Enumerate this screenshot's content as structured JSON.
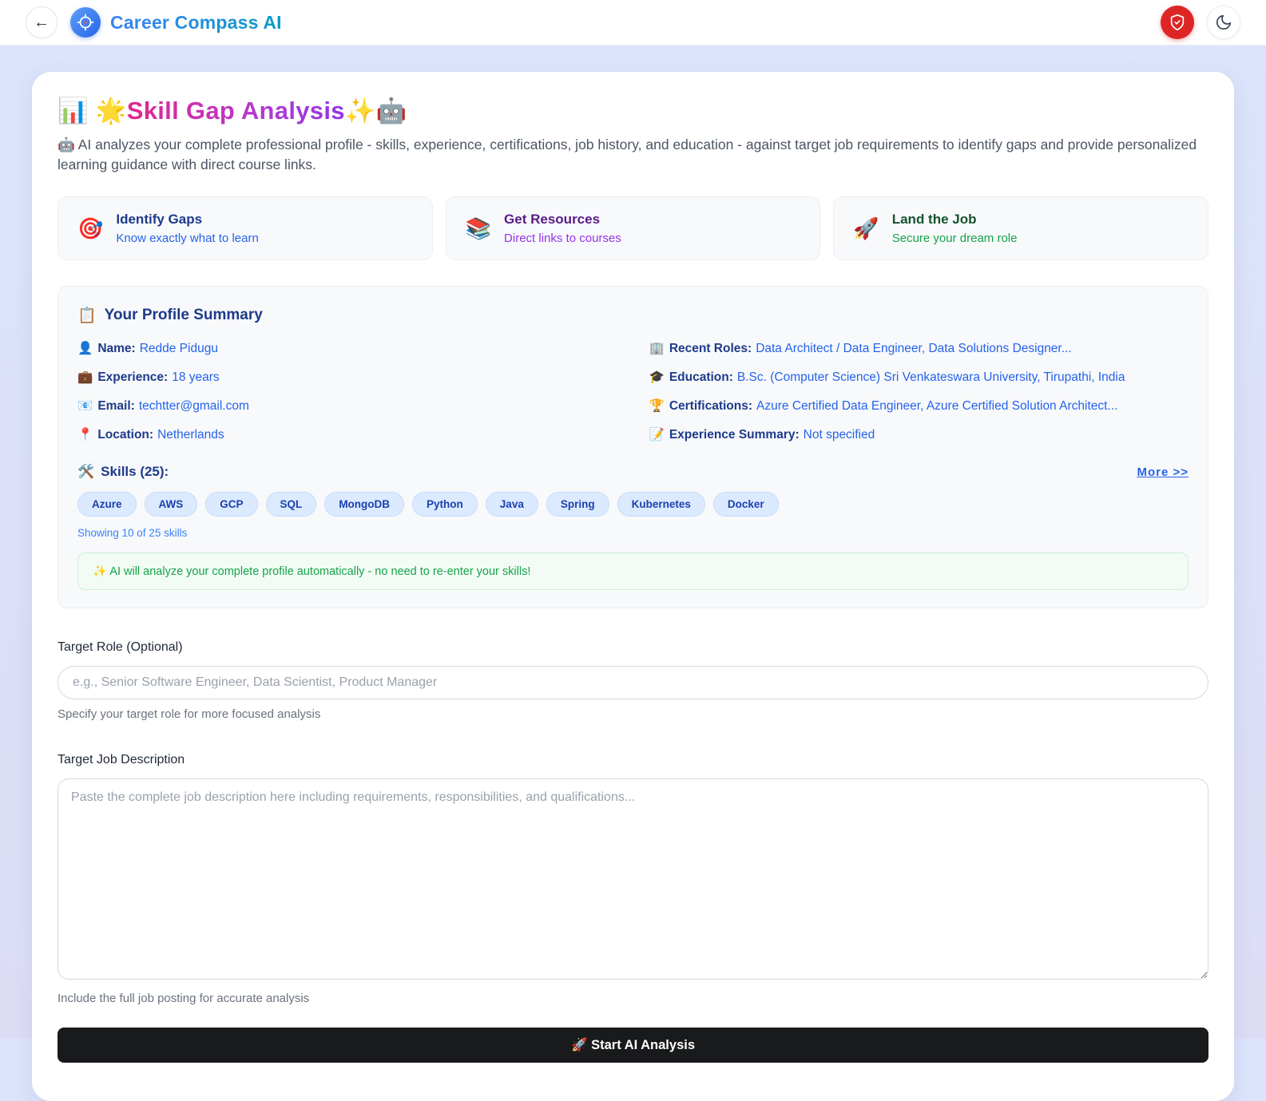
{
  "colors": {
    "page_bg_top": "#dbe4fb",
    "page_bg_bottom": "#dcdcf5",
    "brand_gradient_from": "#3b82f6",
    "brand_gradient_to": "#0a9bc4",
    "title_gradient_from": "#e2268f",
    "title_gradient_to": "#9333ea",
    "shield_button_bg": "#dc2626",
    "chip_bg": "#dbeafe",
    "chip_text": "#1e40af",
    "note_text": "#16a34a",
    "submit_bg": "#181a1b"
  },
  "header": {
    "back_arrow": "←",
    "app_title": "Career Compass AI"
  },
  "page": {
    "title_emoji_left": "📊",
    "title_star": "🌟",
    "title_text": "Skill Gap Analysis",
    "title_emoji_right": "✨🤖",
    "description": "🤖 AI analyzes your complete professional profile - skills, experience, certifications, job history, and education - against target job requirements to identify gaps and provide personalized learning guidance with direct course links."
  },
  "feature_cards": [
    {
      "emoji": "🎯",
      "title": "Identify Gaps",
      "subtitle": "Know exactly what to learn"
    },
    {
      "emoji": "📚",
      "title": "Get Resources",
      "subtitle": "Direct links to courses"
    },
    {
      "emoji": "🚀",
      "title": "Land the Job",
      "subtitle": "Secure your dream role"
    }
  ],
  "profile": {
    "heading_emoji": "📋",
    "heading": "Your Profile Summary",
    "fields_left": [
      {
        "emoji": "👤",
        "label": "Name:",
        "value": "Redde Pidugu"
      },
      {
        "emoji": "💼",
        "label": "Experience:",
        "value": "18 years"
      },
      {
        "emoji": "📧",
        "label": "Email:",
        "value": "techtter@gmail.com"
      },
      {
        "emoji": "📍",
        "label": "Location:",
        "value": "Netherlands"
      }
    ],
    "fields_right": [
      {
        "emoji": "🏢",
        "label": "Recent Roles:",
        "value": "Data Architect / Data Engineer, Data Solutions Designer..."
      },
      {
        "emoji": "🎓",
        "label": "Education:",
        "value": "B.Sc. (Computer Science) Sri Venkateswara University, Tirupathi, India"
      },
      {
        "emoji": "🏆",
        "label": "Certifications:",
        "value": "Azure Certified Data Engineer, Azure Certified Solution Architect..."
      },
      {
        "emoji": "📝",
        "label": "Experience Summary:",
        "value": "Not specified"
      }
    ],
    "skills": {
      "emoji": "🛠️",
      "heading": "Skills (25):",
      "more_link": "More >>",
      "chips": [
        "Azure",
        "AWS",
        "GCP",
        "SQL",
        "MongoDB",
        "Python",
        "Java",
        "Spring",
        "Kubernetes",
        "Docker"
      ],
      "showing_text": "Showing 10 of 25 skills"
    },
    "ai_note": "✨  AI will analyze your complete profile automatically - no need to re-enter your skills!"
  },
  "form": {
    "target_role": {
      "label": "Target Role (Optional)",
      "placeholder": "e.g., Senior Software Engineer, Data Scientist, Product Manager",
      "value": "",
      "helper": "Specify your target role for more focused analysis"
    },
    "job_description": {
      "label": "Target Job Description",
      "placeholder": "Paste the complete job description here including requirements, responsibilities, and qualifications...",
      "value": "",
      "helper": "Include the full job posting for accurate analysis"
    },
    "submit_label": "🚀 Start AI Analysis"
  }
}
